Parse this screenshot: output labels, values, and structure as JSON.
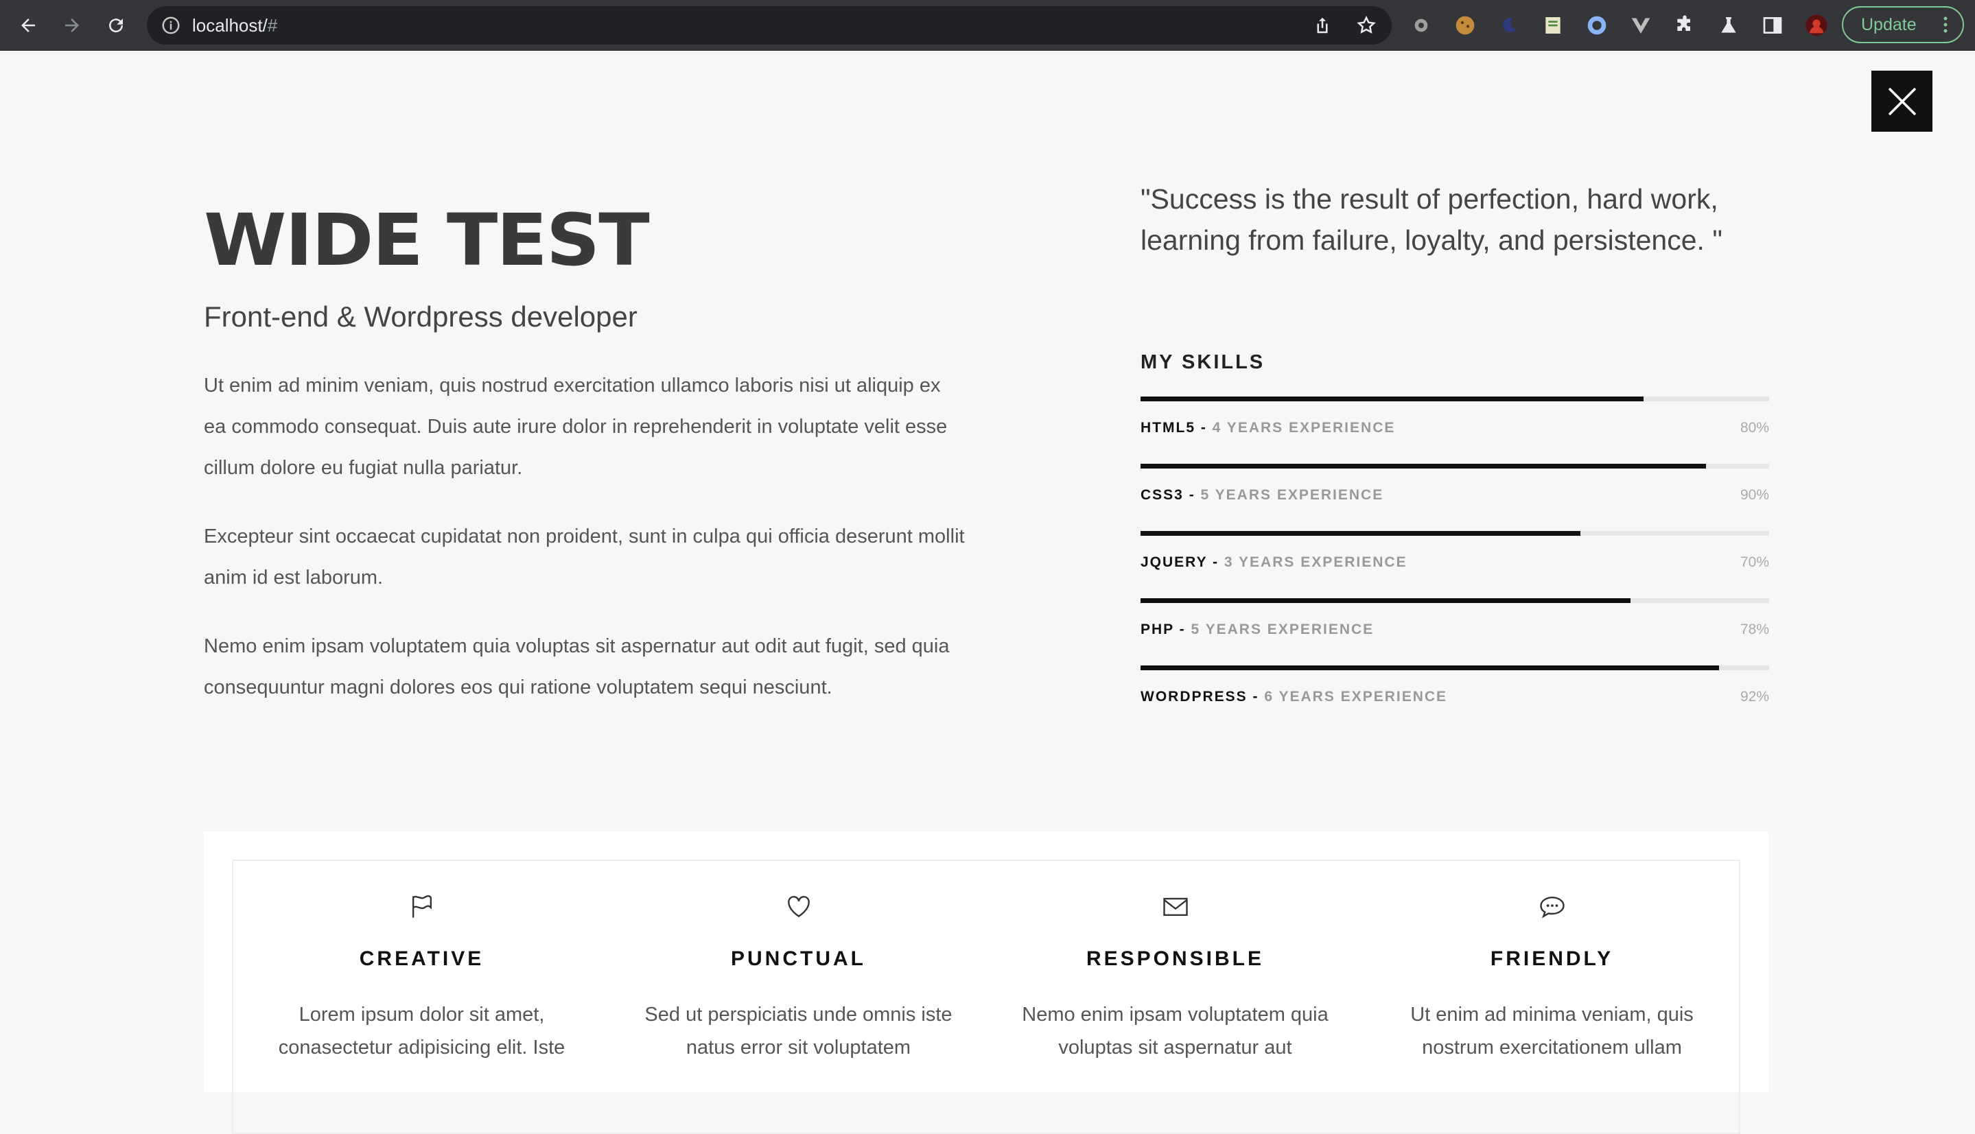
{
  "browser": {
    "url_host": "localhost/",
    "url_hash": "#",
    "update_label": "Update"
  },
  "hero": {
    "title": "WIDE TEST",
    "subtitle": "Front-end & Wordpress developer",
    "paragraphs": [
      "Ut enim ad minim veniam, quis nostrud exercitation ullamco laboris nisi ut aliquip ex ea commodo consequat. Duis aute irure dolor in reprehenderit in voluptate velit esse cillum dolore eu fugiat nulla pariatur.",
      "Excepteur sint occaecat cupidatat non proident, sunt in culpa qui officia deserunt mollit anim id est laborum.",
      "Nemo enim ipsam voluptatem quia voluptas sit aspernatur aut odit aut fugit, sed quia consequuntur magni dolores eos qui ratione voluptatem sequi nesciunt."
    ]
  },
  "quote": "\"Success is the result of perfection, hard work, learning from failure, loyalty, and persistence. \"",
  "skills": {
    "title": "MY SKILLS",
    "items": [
      {
        "name": "HTML5",
        "sep": " - ",
        "experience": "4 YEARS EXPERIENCE",
        "percent_label": "80%",
        "level": 0.8
      },
      {
        "name": "CSS3",
        "sep": " - ",
        "experience": "5 YEARS EXPERIENCE",
        "percent_label": "90%",
        "level": 0.9
      },
      {
        "name": "JQUERY",
        "sep": " - ",
        "experience": "3 YEARS EXPERIENCE",
        "percent_label": "70%",
        "level": 0.7
      },
      {
        "name": "PHP",
        "sep": " - ",
        "experience": "5 YEARS EXPERIENCE",
        "percent_label": "78%",
        "level": 0.78
      },
      {
        "name": "WORDPRESS",
        "sep": " - ",
        "experience": "6 YEARS EXPERIENCE",
        "percent_label": "92%",
        "level": 0.92
      }
    ]
  },
  "features": [
    {
      "icon": "flag-icon",
      "title": "CREATIVE",
      "text": "Lorem ipsum dolor sit amet, conasectetur adipisicing elit. Iste"
    },
    {
      "icon": "heart-icon",
      "title": "PUNCTUAL",
      "text": "Sed ut perspiciatis unde omnis iste natus error sit voluptatem"
    },
    {
      "icon": "envelope-icon",
      "title": "RESPONSIBLE",
      "text": "Nemo enim ipsam voluptatem quia voluptas sit aspernatur aut"
    },
    {
      "icon": "chat-icon",
      "title": "FRIENDLY",
      "text": "Ut enim ad minima veniam, quis nostrum exercitationem ullam"
    }
  ]
}
